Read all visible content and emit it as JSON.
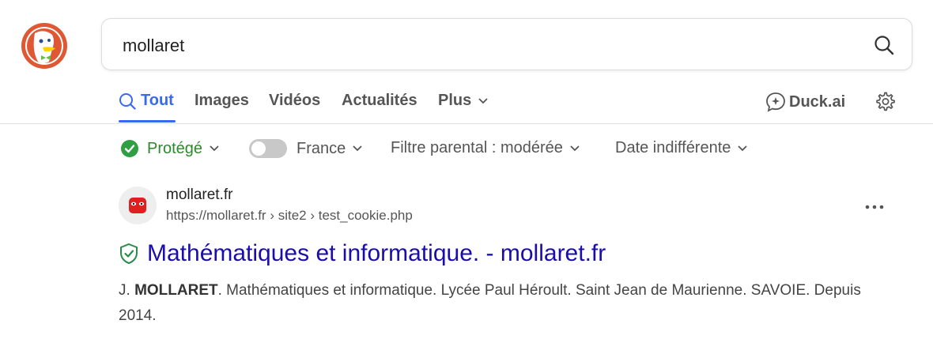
{
  "search": {
    "query": "mollaret"
  },
  "tabs": [
    {
      "label": "Tout"
    },
    {
      "label": "Images"
    },
    {
      "label": "Vidéos"
    },
    {
      "label": "Actualités"
    },
    {
      "label": "Plus"
    }
  ],
  "duckai_label": "Duck.ai",
  "filters": {
    "protection": "Protégé",
    "region": "France",
    "parental": "Filtre parental : modérée",
    "date": "Date indifférente"
  },
  "result": {
    "site_name": "mollaret.fr",
    "url": "https://mollaret.fr › site2 › test_cookie.php",
    "title": "Mathématiques et informatique. - mollaret.fr",
    "snippet_bold": "MOLLARET",
    "snippet_prefix": "J. ",
    "snippet_rest": ". Mathématiques et informatique. Lycée Paul Héroult. Saint Jean de Maurienne. SAVOIE. Depuis 2014."
  },
  "colors": {
    "accent": "#3969ef",
    "link": "#1a0dab",
    "protected": "#2a8a2a",
    "logo": "#de5833"
  },
  "icons": [
    "duckduckgo-logo",
    "search-icon",
    "chevron-down-icon",
    "duckai-icon",
    "gear-icon",
    "check-circle-icon",
    "shield-check-icon",
    "more-horizontal-icon"
  ]
}
